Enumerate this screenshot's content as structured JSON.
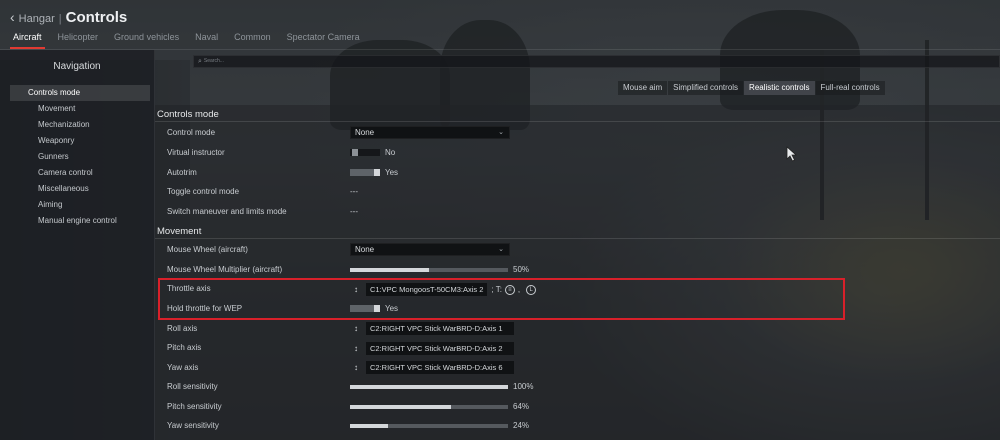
{
  "header": {
    "back_label": "Hangar",
    "title": "Controls",
    "tabs": [
      "Aircraft",
      "Helicopter",
      "Ground vehicles",
      "Naval",
      "Common",
      "Spectator Camera"
    ]
  },
  "sidebar": {
    "title": "Navigation",
    "items": [
      "Controls mode",
      "Movement",
      "Mechanization",
      "Weaponry",
      "Gunners",
      "Camera control",
      "Miscellaneous",
      "Aiming",
      "Manual engine control"
    ]
  },
  "search": {
    "placeholder": "Search..."
  },
  "mode_tabs": [
    "Mouse aim",
    "Simplified controls",
    "Realistic controls",
    "Full-real controls"
  ],
  "controls_mode": {
    "title": "Controls mode",
    "rows": {
      "control_mode": {
        "label": "Control mode",
        "value": "None"
      },
      "virtual_instructor": {
        "label": "Virtual instructor",
        "value": "No"
      },
      "autotrim": {
        "label": "Autotrim",
        "value": "Yes"
      },
      "toggle_control_mode": {
        "label": "Toggle control mode",
        "value": "---"
      },
      "switch_maneuver": {
        "label": "Switch maneuver and limits mode",
        "value": "---"
      }
    }
  },
  "movement": {
    "title": "Movement",
    "rows": {
      "mouse_wheel": {
        "label": "Mouse Wheel (aircraft)",
        "value": "None"
      },
      "mouse_wheel_multiplier": {
        "label": "Mouse Wheel Multiplier (aircraft)",
        "value": "50%",
        "fraction": 0.5
      },
      "throttle_axis": {
        "label": "Throttle axis",
        "value": "C1:VPC MongoosT-50CM3:Axis  2",
        "suffix": "; T:",
        "sep": ","
      },
      "hold_throttle": {
        "label": "Hold throttle for WEP",
        "value": "Yes"
      },
      "roll_axis": {
        "label": "Roll axis",
        "value": "C2:RIGHT VPC Stick WarBRD-D:Axis  1"
      },
      "pitch_axis": {
        "label": "Pitch axis",
        "value": "C2:RIGHT VPC Stick WarBRD-D:Axis  2"
      },
      "yaw_axis": {
        "label": "Yaw axis",
        "value": "C2:RIGHT VPC Stick WarBRD-D:Axis  6"
      },
      "roll_sensitivity": {
        "label": "Roll sensitivity",
        "value": "100%",
        "fraction": 1.0
      },
      "pitch_sensitivity": {
        "label": "Pitch sensitivity",
        "value": "64%",
        "fraction": 0.64
      },
      "yaw_sensitivity": {
        "label": "Yaw sensitivity",
        "value": "24%",
        "fraction": 0.24
      }
    }
  },
  "colors": {
    "accent_red": "#e23a32",
    "highlight_red": "#d8202a"
  }
}
